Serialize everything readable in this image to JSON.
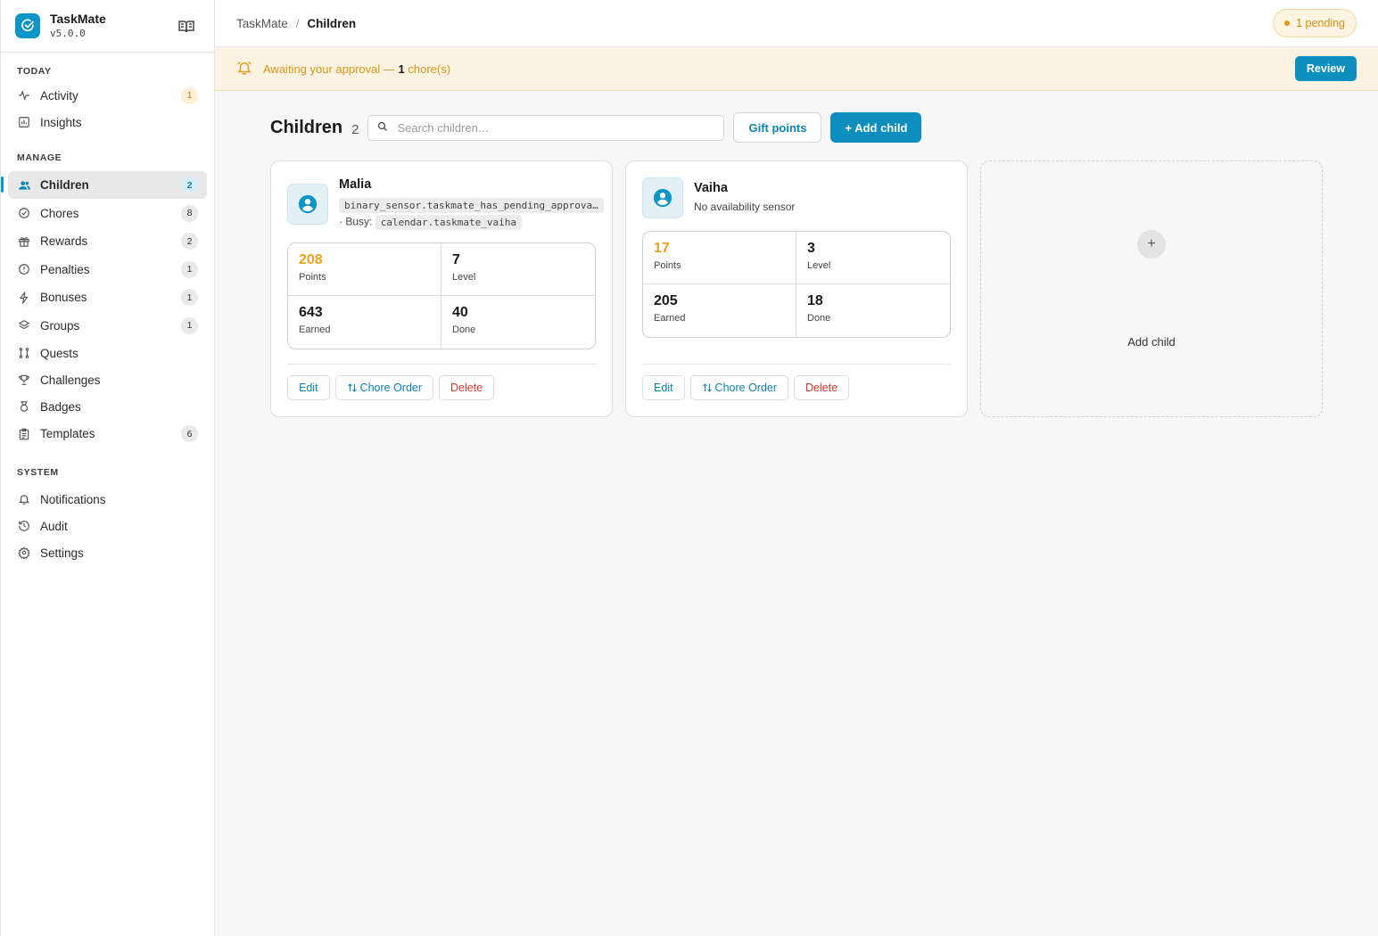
{
  "brand": {
    "name": "TaskMate",
    "version": "v5.0.0"
  },
  "sidebar": {
    "sections": [
      {
        "label": "TODAY",
        "items": [
          {
            "label": "Activity",
            "icon": "activity-icon",
            "count": "1",
            "count_style": "warn"
          },
          {
            "label": "Insights",
            "icon": "chart-icon",
            "count": ""
          }
        ]
      },
      {
        "label": "MANAGE",
        "items": [
          {
            "label": "Children",
            "icon": "users-icon",
            "count": "2",
            "active": true
          },
          {
            "label": "Chores",
            "icon": "check-circle-icon",
            "count": "8"
          },
          {
            "label": "Rewards",
            "icon": "gift-icon",
            "count": "2"
          },
          {
            "label": "Penalties",
            "icon": "alert-circle-icon",
            "count": "1"
          },
          {
            "label": "Bonuses",
            "icon": "bolt-icon",
            "count": "1"
          },
          {
            "label": "Groups",
            "icon": "layers-icon",
            "count": "1"
          },
          {
            "label": "Quests",
            "icon": "route-icon",
            "count": ""
          },
          {
            "label": "Challenges",
            "icon": "trophy-icon",
            "count": ""
          },
          {
            "label": "Badges",
            "icon": "medal-icon",
            "count": ""
          },
          {
            "label": "Templates",
            "icon": "clipboard-icon",
            "count": "6"
          }
        ]
      },
      {
        "label": "SYSTEM",
        "items": [
          {
            "label": "Notifications",
            "icon": "bell-icon",
            "count": ""
          },
          {
            "label": "Audit",
            "icon": "history-icon",
            "count": ""
          },
          {
            "label": "Settings",
            "icon": "gear-icon",
            "count": ""
          }
        ]
      }
    ]
  },
  "topbar": {
    "breadcrumb_root": "TaskMate",
    "breadcrumb_sep": "/",
    "breadcrumb_current": "Children",
    "pending_label": "1 pending"
  },
  "banner": {
    "prefix": "Awaiting your approval — ",
    "count": "1",
    "suffix": " chore(s)",
    "review_label": "Review"
  },
  "page": {
    "title": "Children",
    "count": "2",
    "search_placeholder": "Search children…",
    "gift_label": "Gift points",
    "add_label": "+ Add child"
  },
  "children": [
    {
      "name": "Malia",
      "sensor": "binary_sensor.taskmate_has_pending_approva…",
      "busy_label": "· Busy:",
      "busy_entity": "calendar.taskmate_vaiha",
      "stats": [
        {
          "value": "208",
          "label": "Points"
        },
        {
          "value": "7",
          "label": "Level"
        },
        {
          "value": "643",
          "label": "Earned"
        },
        {
          "value": "40",
          "label": "Done"
        }
      ],
      "actions": {
        "edit": "Edit",
        "order": "Chore Order",
        "delete": "Delete"
      }
    },
    {
      "name": "Vaiha",
      "availability": "No availability sensor",
      "stats": [
        {
          "value": "17",
          "label": "Points"
        },
        {
          "value": "3",
          "label": "Level"
        },
        {
          "value": "205",
          "label": "Earned"
        },
        {
          "value": "18",
          "label": "Done"
        }
      ],
      "actions": {
        "edit": "Edit",
        "order": "Chore Order",
        "delete": "Delete"
      }
    }
  ],
  "add_card": {
    "icon": "+",
    "label": "Add child"
  },
  "colors": {
    "accent": "#0c8fbf",
    "points": "#eea21c",
    "warning": "#d6961a",
    "danger": "#d23a2a"
  }
}
